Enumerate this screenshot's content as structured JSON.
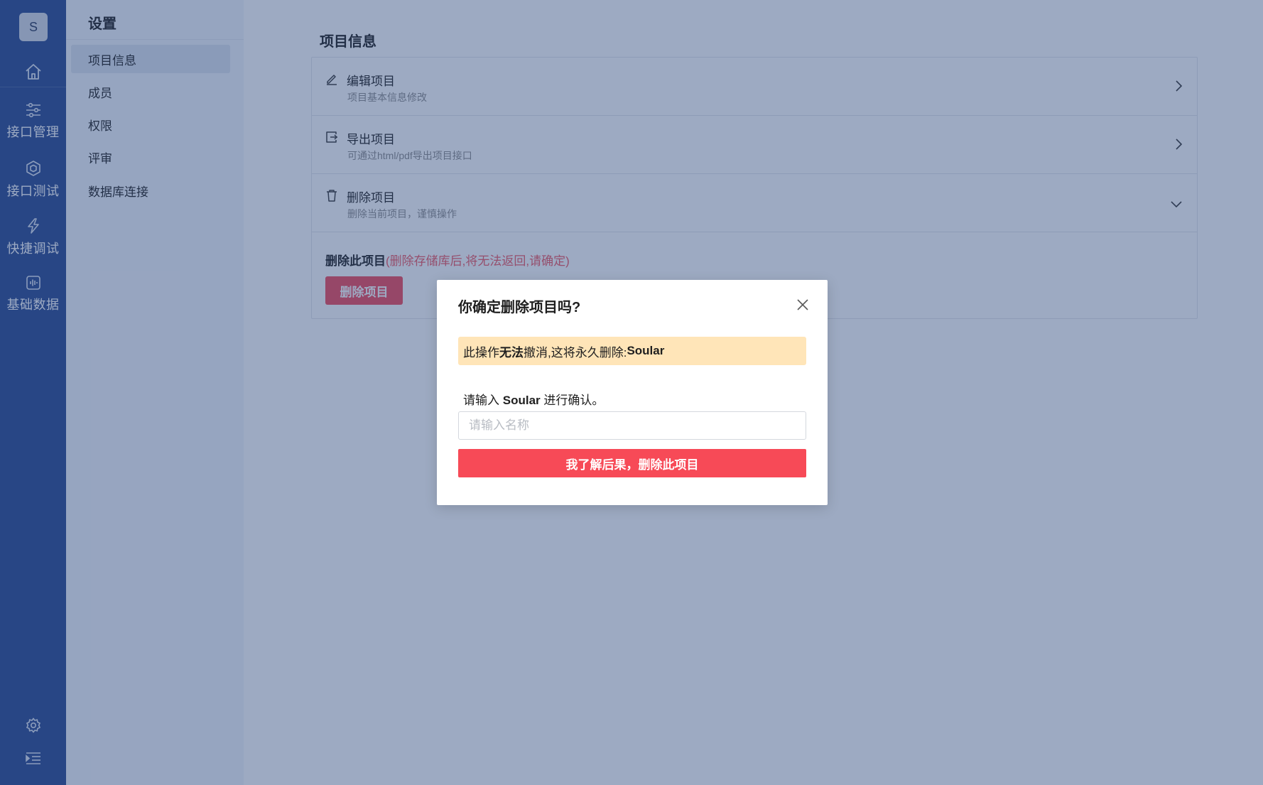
{
  "rail": {
    "avatar_letter": "S",
    "nav": [
      {
        "label": "接口管理",
        "icon": "sliders-icon"
      },
      {
        "label": "接口测试",
        "icon": "cube-icon"
      },
      {
        "label": "快捷调试",
        "icon": "lightning-icon"
      },
      {
        "label": "基础数据",
        "icon": "waveform-icon"
      }
    ],
    "bottom_icons": [
      "gear-icon",
      "indent-menu-icon"
    ]
  },
  "sidebar": {
    "title": "设置",
    "items": [
      {
        "label": "项目信息",
        "active": true
      },
      {
        "label": "成员",
        "active": false
      },
      {
        "label": "权限",
        "active": false
      },
      {
        "label": "评审",
        "active": false
      },
      {
        "label": "数据库连接",
        "active": false
      }
    ]
  },
  "main": {
    "heading": "项目信息",
    "rows": [
      {
        "title": "编辑项目",
        "subtitle": "项目基本信息修改",
        "icon": "edit-icon",
        "expanded": false
      },
      {
        "title": "导出项目",
        "subtitle": "可通过html/pdf导出项目接口",
        "icon": "export-icon",
        "expanded": false
      },
      {
        "title": "删除项目",
        "subtitle": "删除当前项目，谨慎操作",
        "icon": "trash-icon",
        "expanded": true
      }
    ],
    "delete_section": {
      "label": "删除此项目",
      "warning": "(删除存储库后,将无法返回,请确定)",
      "button": "删除项目"
    }
  },
  "modal": {
    "title": "你确定删除项目吗?",
    "alert_prefix": "此操作",
    "alert_bold": "无法",
    "alert_middle": "撤消,这将永久删除:",
    "alert_project": "Soular",
    "prompt_prefix": "请输入",
    "prompt_project": "Soular",
    "prompt_suffix": "进行确认。",
    "input_value": "",
    "input_placeholder": "请输入名称",
    "confirm_button": "我了解后果，删除此项目"
  },
  "colors": {
    "rail_bg": "#2a4a91",
    "danger": "#f74a57",
    "alert_bg": "#ffe5b8",
    "overlay": "rgba(38,66,120,0.45)"
  }
}
